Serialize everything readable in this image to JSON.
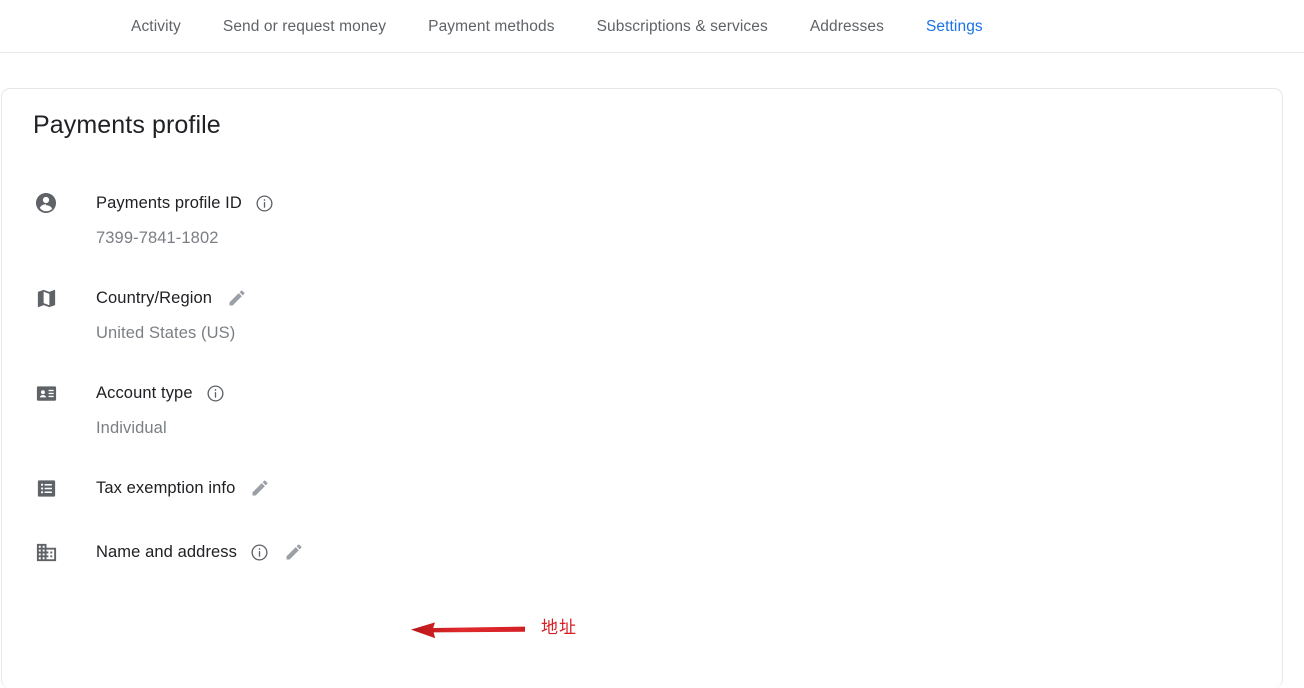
{
  "nav": {
    "tabs": [
      {
        "label": "Activity",
        "active": false,
        "name": "tab-activity"
      },
      {
        "label": "Send or request money",
        "active": false,
        "name": "tab-send-or-request-money"
      },
      {
        "label": "Payment methods",
        "active": false,
        "name": "tab-payment-methods"
      },
      {
        "label": "Subscriptions & services",
        "active": false,
        "name": "tab-subscriptions-and-services"
      },
      {
        "label": "Addresses",
        "active": false,
        "name": "tab-addresses"
      },
      {
        "label": "Settings",
        "active": true,
        "name": "tab-settings"
      }
    ],
    "active_tab": "Settings",
    "active_color": "#1a73e8",
    "inactive_color": "#5f6368"
  },
  "card": {
    "title": "Payments profile",
    "rows": [
      {
        "icon": "account-circle-icon",
        "label": "Payments profile ID",
        "value": "7399-7841-1802",
        "has_info": true,
        "has_edit": false
      },
      {
        "icon": "map-icon",
        "label": "Country/Region",
        "value": "United States (US)",
        "has_info": false,
        "has_edit": true
      },
      {
        "icon": "contact-card-icon",
        "label": "Account type",
        "value": "Individual",
        "has_info": true,
        "has_edit": false
      },
      {
        "icon": "list-receipt-icon",
        "label": "Tax exemption info",
        "value": "",
        "has_info": false,
        "has_edit": true
      },
      {
        "icon": "business-building-icon",
        "label": "Name and address",
        "value": "",
        "has_info": true,
        "has_edit": true
      }
    ]
  },
  "annotation": {
    "text": "地址",
    "arrow": "left-arrow-annotation",
    "color": "#d81f22"
  }
}
